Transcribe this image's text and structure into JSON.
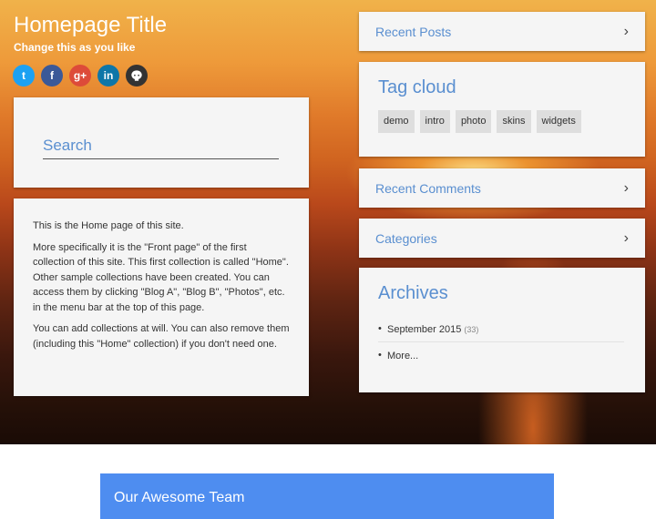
{
  "header": {
    "title": "Homepage Title",
    "subtitle": "Change this as you like"
  },
  "social": [
    {
      "name": "twitter",
      "glyph": "t",
      "color": "#1da1f2"
    },
    {
      "name": "facebook",
      "glyph": "f",
      "color": "#3b5998"
    },
    {
      "name": "google-plus",
      "glyph": "g+",
      "color": "#dd4b39"
    },
    {
      "name": "linkedin",
      "glyph": "in",
      "color": "#0e76a8"
    },
    {
      "name": "github",
      "glyph": "●",
      "color": "#333333"
    }
  ],
  "search": {
    "placeholder": "Search"
  },
  "intro": {
    "p1": "This is the Home page of this site.",
    "p2": "More specifically it is the \"Front page\" of the first collection of this site. This first collection is called \"Home\". Other sample collections have been created. You can access them by clicking \"Blog A\", \"Blog B\", \"Photos\", etc. in the menu bar at the top of this page.",
    "p3": "You can add collections at will. You can also remove them (including this \"Home\" collection) if you don't need one."
  },
  "sidebar": {
    "recent_posts": "Recent Posts",
    "tag_cloud_title": "Tag cloud",
    "tags": [
      "demo",
      "intro",
      "photo",
      "skins",
      "widgets"
    ],
    "recent_comments": "Recent Comments",
    "categories": "Categories",
    "archives_title": "Archives",
    "archives": {
      "month": "September 2015",
      "count": "(33)",
      "more": "More..."
    }
  },
  "team": {
    "title": "Our Awesome Team"
  },
  "colors": {
    "accent": "#5a8fd0",
    "banner": "#4e8df0",
    "card": "#f5f5f5"
  }
}
